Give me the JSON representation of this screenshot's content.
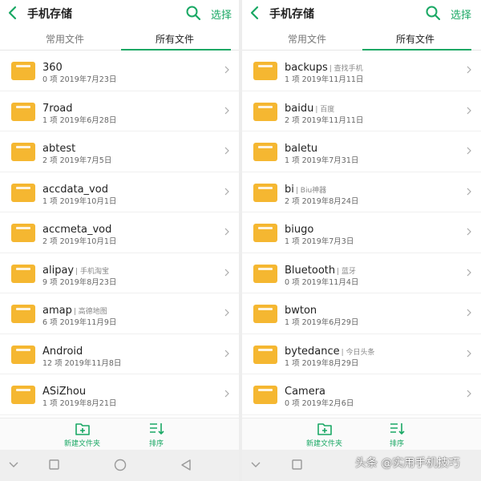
{
  "colors": {
    "accent": "#19a864",
    "folder": "#f5b731",
    "folder_tab": "#f9d16a"
  },
  "watermark": "头条 @实用手机技巧",
  "panels": [
    {
      "header": {
        "title": "手机存储",
        "select": "选择"
      },
      "tabs": [
        {
          "label": "常用文件"
        },
        {
          "label": "所有文件"
        }
      ],
      "folders": [
        {
          "name": "360",
          "alias": "",
          "meta": "0 项  2019年7月23日"
        },
        {
          "name": "7road",
          "alias": "",
          "meta": "1 项  2019年6月28日"
        },
        {
          "name": "abtest",
          "alias": "",
          "meta": "2 项  2019年7月5日"
        },
        {
          "name": "accdata_vod",
          "alias": "",
          "meta": "1 项  2019年10月1日"
        },
        {
          "name": "accmeta_vod",
          "alias": "",
          "meta": "2 项  2019年10月1日"
        },
        {
          "name": "alipay",
          "alias": "| 手机淘宝",
          "meta": "9 项  2019年8月23日"
        },
        {
          "name": "amap",
          "alias": "| 高德地图",
          "meta": "6 项  2019年11月9日"
        },
        {
          "name": "Android",
          "alias": "",
          "meta": "12 项  2019年11月8日"
        },
        {
          "name": "ASiZhou",
          "alias": "",
          "meta": "1 项  2019年8月21日"
        }
      ],
      "actions": {
        "new_folder": "新建文件夹",
        "sort": "排序"
      }
    },
    {
      "header": {
        "title": "手机存储",
        "select": "选择"
      },
      "tabs": [
        {
          "label": "常用文件"
        },
        {
          "label": "所有文件"
        }
      ],
      "folders": [
        {
          "name": "backups",
          "alias": "| 查找手机",
          "meta": "1 项  2019年11月11日"
        },
        {
          "name": "baidu",
          "alias": "| 百度",
          "meta": "2 项  2019年11月11日"
        },
        {
          "name": "baletu",
          "alias": "",
          "meta": "1 项  2019年7月31日"
        },
        {
          "name": "bi",
          "alias": "| Biu神器",
          "meta": "2 项  2019年8月24日"
        },
        {
          "name": "biugo",
          "alias": "",
          "meta": "1 项  2019年7月3日"
        },
        {
          "name": "Bluetooth",
          "alias": "| 蓝牙",
          "meta": "0 项  2019年11月4日"
        },
        {
          "name": "bwton",
          "alias": "",
          "meta": "1 项  2019年6月29日"
        },
        {
          "name": "bytedance",
          "alias": "| 今日头条",
          "meta": "1 项  2019年8月29日"
        },
        {
          "name": "Camera",
          "alias": "",
          "meta": "0 项  2019年2月6日"
        }
      ],
      "actions": {
        "new_folder": "新建文件夹",
        "sort": "排序"
      }
    }
  ]
}
